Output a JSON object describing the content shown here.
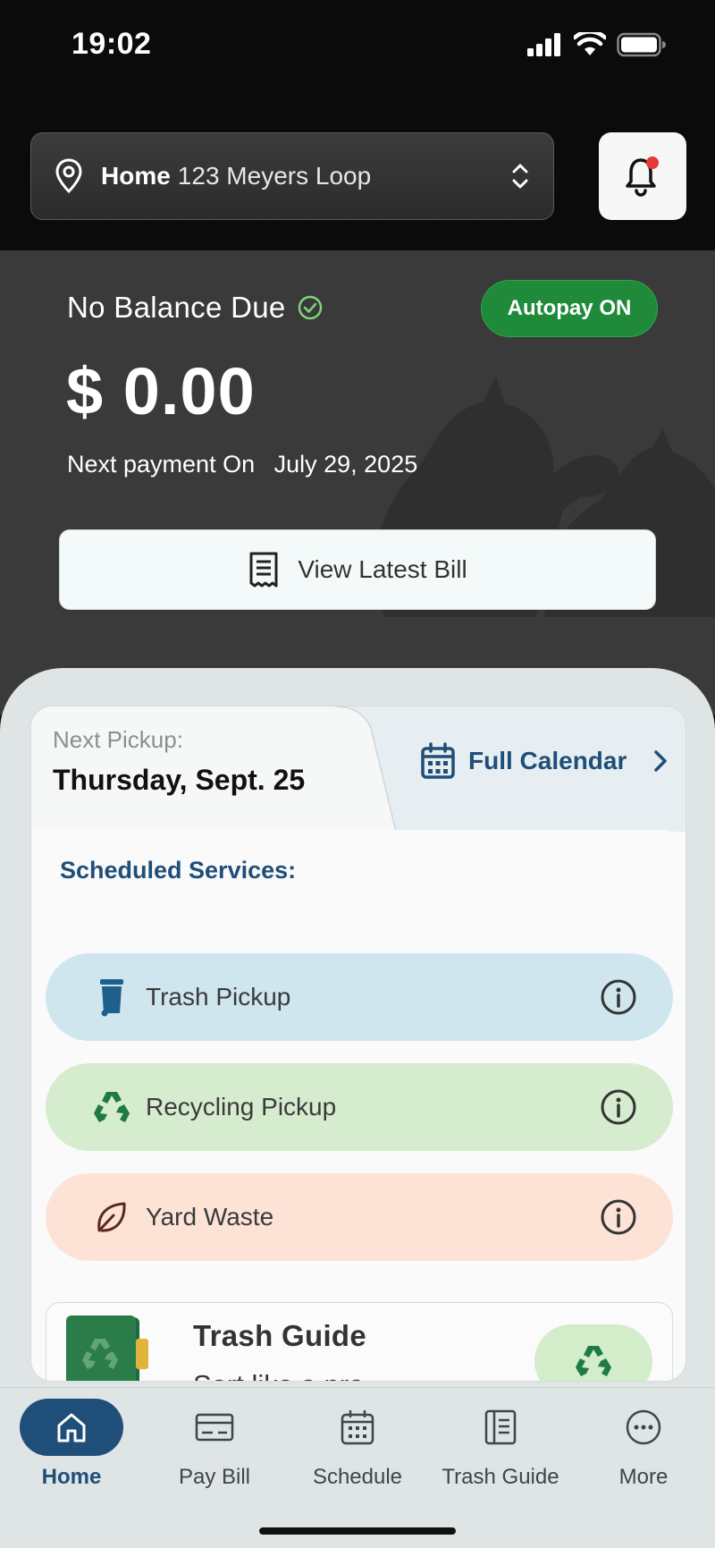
{
  "status_bar": {
    "time": "19:02",
    "icons": [
      "signal-icon",
      "wifi-icon",
      "battery-icon"
    ]
  },
  "header": {
    "address_name": "Home",
    "address_street": "123 Meyers Loop",
    "notification_dot_color": "#e53935"
  },
  "balance": {
    "status": "No Balance Due",
    "autopay_label": "Autopay ON",
    "amount": "$ 0.00",
    "next_payment_label": "Next payment On",
    "next_payment_date": "July 29, 2025",
    "view_bill_label": "View Latest Bill"
  },
  "pickup": {
    "next_label": "Next Pickup:",
    "next_date": "Thursday, Sept. 25",
    "calendar_label": "Full Calendar",
    "services_title": "Scheduled Services:",
    "services": [
      {
        "label": "Trash Pickup",
        "color": "#cfe6ef",
        "icon": "trash-bin-icon"
      },
      {
        "label": "Recycling Pickup",
        "color": "#d6eccf",
        "icon": "recycle-icon"
      },
      {
        "label": "Yard Waste",
        "color": "#fde3d6",
        "icon": "leaf-icon"
      }
    ]
  },
  "guide": {
    "title": "Trash Guide",
    "subtitle": "Sort like a pro"
  },
  "nav": {
    "items": [
      {
        "label": "Home",
        "icon": "home-icon",
        "active": true
      },
      {
        "label": "Pay Bill",
        "icon": "card-icon",
        "active": false
      },
      {
        "label": "Schedule",
        "icon": "calendar-icon",
        "active": false
      },
      {
        "label": "Trash Guide",
        "icon": "guide-icon",
        "active": false
      },
      {
        "label": "More",
        "icon": "more-icon",
        "active": false
      }
    ]
  },
  "colors": {
    "accent": "#1f4e79",
    "autopay_green": "#1f8a3a",
    "balance_bg": "#3a3a3a"
  }
}
